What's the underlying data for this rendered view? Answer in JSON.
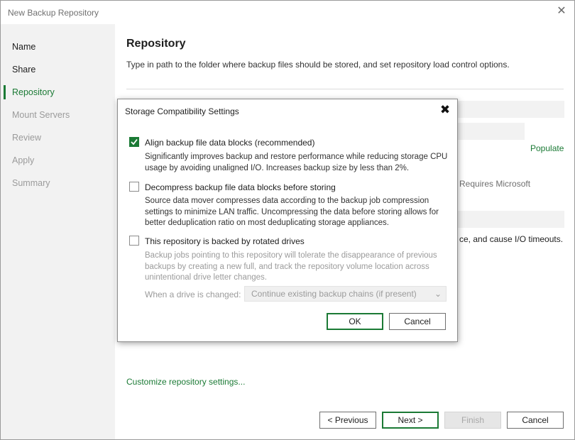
{
  "window": {
    "title": "New Backup Repository",
    "close_glyph": "✕"
  },
  "sidebar": {
    "steps": [
      {
        "label": "Name",
        "state": "normal"
      },
      {
        "label": "Share",
        "state": "normal"
      },
      {
        "label": "Repository",
        "state": "active"
      },
      {
        "label": "Mount Servers",
        "state": "disabled"
      },
      {
        "label": "Review",
        "state": "disabled"
      },
      {
        "label": "Apply",
        "state": "disabled"
      },
      {
        "label": "Summary",
        "state": "disabled"
      }
    ]
  },
  "main": {
    "heading": "Repository",
    "subtitle": "Type in path to the folder where backup files should be stored, and set repository load control options.",
    "populate_link": "Populate",
    "partial_text_1": "Requires Microsoft",
    "partial_text_2": "ce, and cause I/O timeouts.",
    "customize_link": "Customize repository settings..."
  },
  "footer": {
    "previous": "< Previous",
    "next": "Next >",
    "finish": "Finish",
    "cancel": "Cancel"
  },
  "dialog": {
    "title": "Storage Compatibility Settings",
    "close_glyph": "✖",
    "options": [
      {
        "label": "Align backup file data blocks (recommended)",
        "checked": true,
        "enabled": true,
        "description": "Significantly improves backup and restore performance while reducing storage CPU usage by avoiding unaligned I/O. Increases backup size by less than 2%."
      },
      {
        "label": "Decompress backup file data blocks before storing",
        "checked": false,
        "enabled": true,
        "description": "Source data mover compresses data according to the backup job compression settings to minimize LAN traffic. Uncompressing the data before storing allows for better deduplication ratio on most deduplicating storage appliances."
      },
      {
        "label": "This repository is backed by rotated drives",
        "checked": false,
        "enabled": true,
        "description": "Backup jobs pointing to this repository will tolerate the disappearance of previous backups by creating a new full, and track the repository volume location across unintentional drive letter changes."
      }
    ],
    "drive_change_label": "When a drive is changed:",
    "drive_change_value": "Continue existing backup chains (if present)",
    "ok": "OK",
    "cancel": "Cancel"
  },
  "colors": {
    "accent": "#1b7a35",
    "sidebar_bg": "#f2f2f2",
    "disabled_text": "#9b9b9b"
  },
  "icons": {
    "window_close": "close-icon",
    "dialog_close": "close-icon",
    "checkbox_check": "check-icon",
    "dropdown": "chevron-down-icon"
  }
}
